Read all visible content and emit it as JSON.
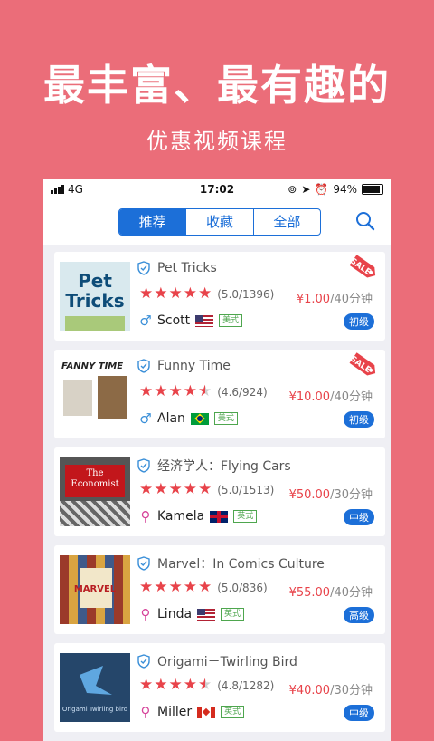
{
  "promo": {
    "headline": "最丰富、最有趣的",
    "subheadline": "优惠视频课程"
  },
  "status_bar": {
    "network": "4G",
    "time": "17:02",
    "battery": "94%"
  },
  "tabs": [
    {
      "label": "推荐",
      "active": true
    },
    {
      "label": "收藏",
      "active": false
    },
    {
      "label": "全部",
      "active": false
    }
  ],
  "courses": [
    {
      "title": "Pet Tricks",
      "thumb_line1": "Pet",
      "thumb_line2": "Tricks",
      "rating_stars": 5,
      "rating_text": "(5.0/1396)",
      "price": "¥1.00",
      "duration": "/40分钟",
      "instructor": "Scott",
      "gender": "male",
      "flag": "us",
      "accent": "美式",
      "level": "初级",
      "sale": true
    },
    {
      "title": "Funny Time",
      "thumb_line1": "FANNY TIME",
      "thumb_line2": "",
      "rating_stars": 4.5,
      "rating_text": "(4.6/924)",
      "price": "¥10.00",
      "duration": "/40分钟",
      "instructor": "Alan",
      "gender": "male",
      "flag": "br",
      "accent": "美式",
      "level": "初级",
      "sale": true
    },
    {
      "title": "经济学人：Flying Cars",
      "thumb_line1": "The",
      "thumb_line2": "Economist",
      "rating_stars": 5,
      "rating_text": "(5.0/1513)",
      "price": "¥50.00",
      "duration": "/30分钟",
      "instructor": "Kamela",
      "gender": "female",
      "flag": "uk",
      "accent": "英式",
      "level": "中级",
      "sale": false
    },
    {
      "title": "Marvel：In Comics Culture",
      "thumb_line1": "MARVEL",
      "thumb_line2": "",
      "rating_stars": 5,
      "rating_text": "(5.0/836)",
      "price": "¥55.00",
      "duration": "/40分钟",
      "instructor": "Linda",
      "gender": "female",
      "flag": "us",
      "accent": "英式",
      "level": "高级",
      "sale": false
    },
    {
      "title": "Origami－Twirling Bird",
      "thumb_line1": "Origami Twirling bird",
      "thumb_line2": "",
      "rating_stars": 4.5,
      "rating_text": "(4.8/1282)",
      "price": "¥40.00",
      "duration": "/30分钟",
      "instructor": "Miller",
      "gender": "female",
      "flag": "ca",
      "accent": "英式",
      "level": "中级",
      "sale": false
    }
  ],
  "sale_badge": "SALE",
  "colors": {
    "background": "#EB6D79",
    "accent_blue": "#1C6FD8",
    "price_red": "#E8434A"
  }
}
